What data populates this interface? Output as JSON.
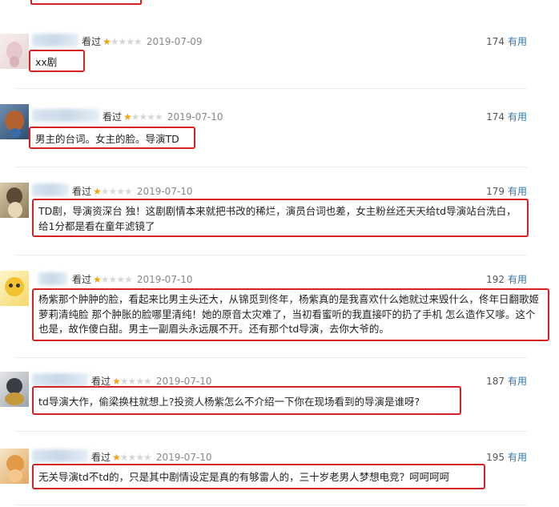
{
  "comments": [
    {
      "status": "看过",
      "stars": 1,
      "date": "2019-07-09",
      "votes": "174",
      "useful_label": "有用",
      "text": "xx剧"
    },
    {
      "status": "看过",
      "stars": 1,
      "date": "2019-07-10",
      "votes": "174",
      "useful_label": "有用",
      "text": "男主的台词。女主的脸。导演TD"
    },
    {
      "status": "看过",
      "stars": 1,
      "date": "2019-07-10",
      "votes": "179",
      "useful_label": "有用",
      "text": "TD剧，导演资深台 独！这剧剧情本来就把书改的稀烂，演员台词也差，女主粉丝还天天给td导演站台洗白，给1分都是看在童年滤镜了"
    },
    {
      "status": "看过",
      "stars": 1,
      "date": "2019-07-10",
      "votes": "192",
      "useful_label": "有用",
      "text": "杨紫那个肿肿的脸，看起来比男主头还大，从锦觅到佟年，杨紫真的是我喜欢什么她就过来毁什么，佟年日翻歌姬萝莉清纯脸 那个肿胀的脸哪里清纯！她的原音太灾难了，当初看蜜听的我直接吓的扔了手机 怎么造作又嗲。这个也是，故作傻白甜。男主一副眉头永远展不开。还有那个td导演，去你大爷的。"
    },
    {
      "status": "看过",
      "stars": 1,
      "date": "2019-07-10",
      "votes": "187",
      "useful_label": "有用",
      "text": "td导演大作，偷梁换柱就想上?投资人杨紫怎么不介绍一下你在现场看到的导演是谁呀?"
    },
    {
      "status": "看过",
      "stars": 1,
      "date": "2019-07-10",
      "votes": "195",
      "useful_label": "有用",
      "text": "无关导演td不td的，只是其中剧情设定是真的有够雷人的，三十岁老男人梦想电竞？呵呵呵呵"
    }
  ]
}
